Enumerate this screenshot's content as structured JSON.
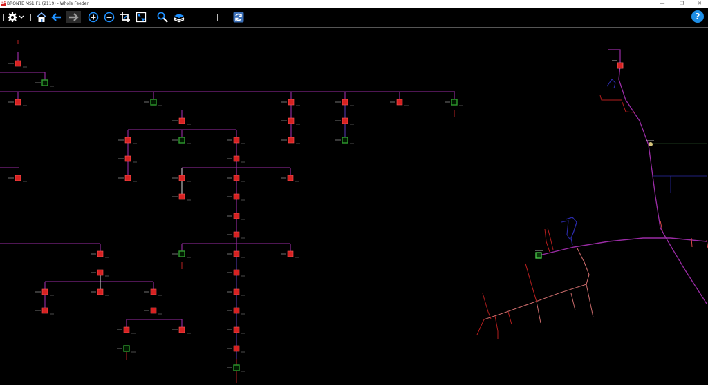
{
  "window": {
    "app_icon_text": "EMS",
    "title": "BRONTE MS1 F1 (2119) - Whole Feeder",
    "controls": {
      "minimize": "—",
      "maximize": "❐",
      "close": "✕"
    }
  },
  "toolbar": {
    "help_label": "?",
    "buttons": [
      "settings",
      "home",
      "back",
      "forward",
      "zoom-in",
      "zoom-out",
      "crop",
      "fit",
      "search",
      "layers",
      "refresh"
    ]
  },
  "colors": {
    "background": "#000000",
    "feeder_line": "#9b2ca6",
    "switch_closed": "#d62222",
    "switch_open": "#2e9a2e",
    "map_blue": "#2a2aa8",
    "map_pink": "#c86a6a",
    "map_red": "#b21e1e",
    "label_text": "#e0e0e0",
    "accent_blue": "#1e90ff"
  }
}
